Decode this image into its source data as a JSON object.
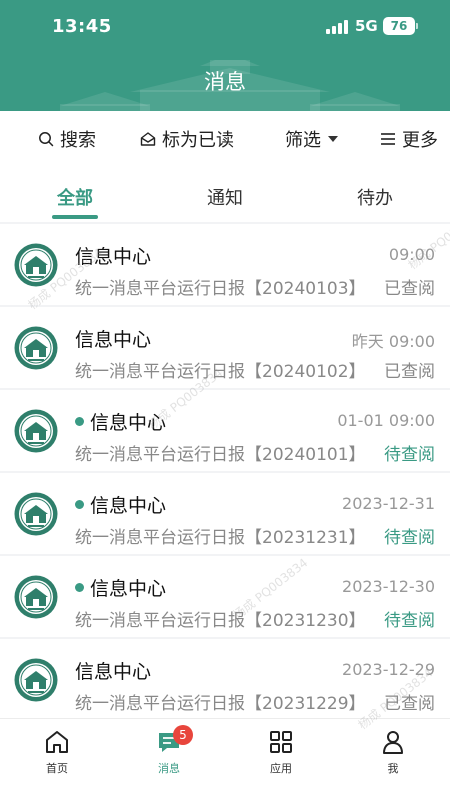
{
  "status_bar": {
    "time": "13:45",
    "network": "5G",
    "battery": "76"
  },
  "header": {
    "title": "消息"
  },
  "toolbar": {
    "search_label": "搜索",
    "mark_read_label": "标为已读",
    "filter_label": "筛选",
    "more_label": "更多"
  },
  "tabs": [
    {
      "label": "全部",
      "active": true
    },
    {
      "label": "通知",
      "active": false
    },
    {
      "label": "待办",
      "active": false
    }
  ],
  "messages": [
    {
      "sender": "信息中心",
      "time": "09:00",
      "subject": "统一消息平台运行日报【20240103】",
      "status": "已查阅",
      "unread": false
    },
    {
      "sender": "信息中心",
      "time": "昨天 09:00",
      "subject": "统一消息平台运行日报【20240102】",
      "status": "已查阅",
      "unread": false
    },
    {
      "sender": "信息中心",
      "time": "01-01 09:00",
      "subject": "统一消息平台运行日报【20240101】",
      "status": "待查阅",
      "unread": true
    },
    {
      "sender": "信息中心",
      "time": "2023-12-31",
      "subject": "统一消息平台运行日报【20231231】",
      "status": "待查阅",
      "unread": true
    },
    {
      "sender": "信息中心",
      "time": "2023-12-30",
      "subject": "统一消息平台运行日报【20231230】",
      "status": "待查阅",
      "unread": true
    },
    {
      "sender": "信息中心",
      "time": "2023-12-29",
      "subject": "统一消息平台运行日报【20231229】",
      "status": "已查阅",
      "unread": false
    }
  ],
  "watermarks": [
    "杨成 PQ003834",
    "杨成 PQ003834",
    "杨成 PQ003834",
    "杨成 PQ003834",
    "杨成 PQ003834"
  ],
  "tabbar": [
    {
      "label": "首页",
      "icon": "home-icon",
      "active": false
    },
    {
      "label": "消息",
      "icon": "message-icon",
      "active": true,
      "badge": "5"
    },
    {
      "label": "应用",
      "icon": "apps-grid-icon",
      "active": false
    },
    {
      "label": "我",
      "icon": "person-icon",
      "active": false
    }
  ],
  "colors": {
    "primary": "#3a9a84",
    "badge": "#e8453c",
    "muted": "#888888"
  }
}
